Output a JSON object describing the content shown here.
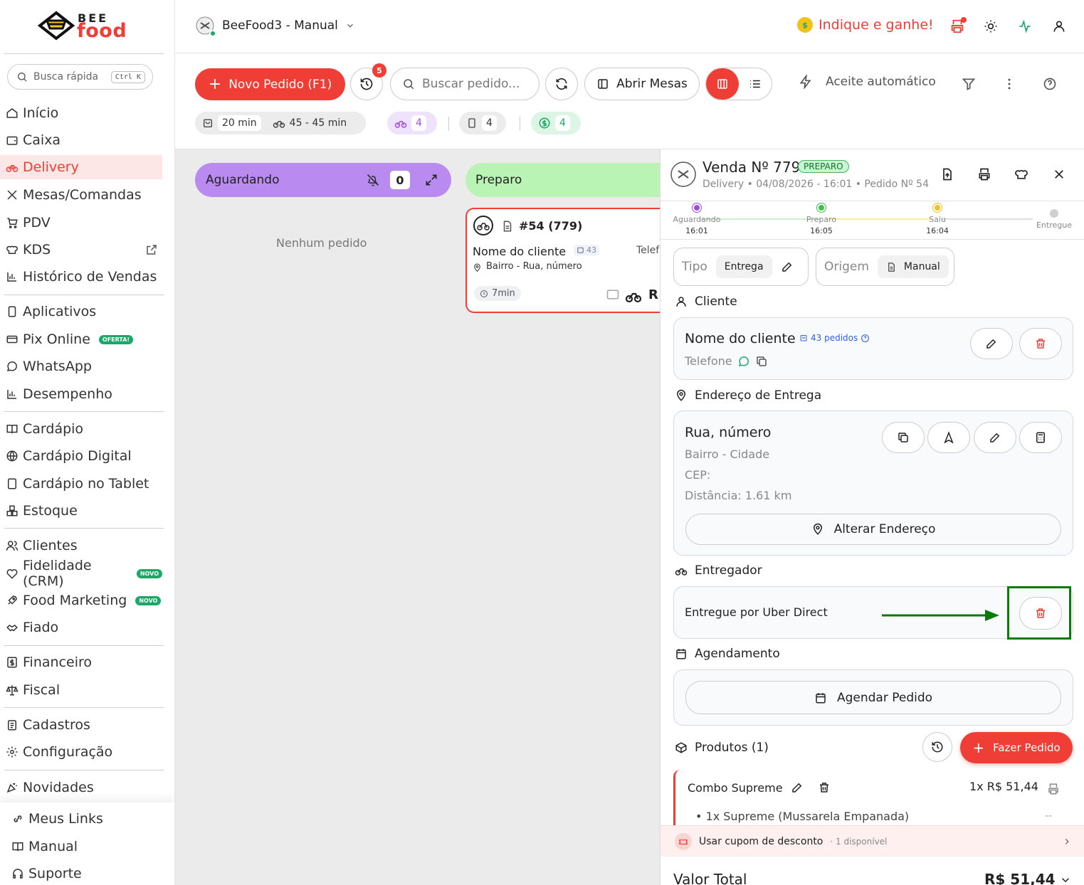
{
  "brand": {
    "bee": "BEE",
    "food": "food"
  },
  "sidebar": {
    "search_placeholder": "Busca rápida",
    "search_kbd": "Ctrl K",
    "items": [
      {
        "label": "Início"
      },
      {
        "label": "Caixa"
      },
      {
        "label": "Delivery",
        "active": true
      },
      {
        "label": "Mesas/Comandas"
      },
      {
        "label": "PDV"
      },
      {
        "label": "KDS"
      },
      {
        "label": "Histórico de Vendas"
      },
      {
        "label": "Aplicativos"
      },
      {
        "label": "Pix Online",
        "badge": "OFERTA!"
      },
      {
        "label": "WhatsApp"
      },
      {
        "label": "Desempenho"
      },
      {
        "label": "Cardápio"
      },
      {
        "label": "Cardápio Digital"
      },
      {
        "label": "Cardápio no Tablet"
      },
      {
        "label": "Estoque"
      },
      {
        "label": "Clientes"
      },
      {
        "label": "Fidelidade (CRM)",
        "badge": "NOVO"
      },
      {
        "label": "Food Marketing",
        "badge": "NOVO"
      },
      {
        "label": "Fiado"
      },
      {
        "label": "Financeiro"
      },
      {
        "label": "Fiscal"
      },
      {
        "label": "Cadastros"
      },
      {
        "label": "Configuração"
      },
      {
        "label": "Novidades"
      }
    ],
    "bottom": [
      {
        "label": "Meus Links"
      },
      {
        "label": "Manual"
      },
      {
        "label": "Suporte"
      }
    ]
  },
  "topbar": {
    "store_name": "BeeFood3 - Manual",
    "indique": "Indique e ganhe!"
  },
  "toolbar": {
    "new_order": "Novo Pedido (F1)",
    "history_badge": "5",
    "search_placeholder": "Buscar pedido...",
    "abrir_mesas": "Abrir Mesas",
    "aceite": "Aceite automático",
    "time_prep": "20 min",
    "time_delivery": "45 - 45 min",
    "count_delivery": "4",
    "count_tablet": "4",
    "count_money": "4"
  },
  "board": {
    "col_aguardando": "Aguardando",
    "col_aguardando_count": "0",
    "col_preparo": "Preparo",
    "empty": "Nenhum pedido",
    "card": {
      "number": "#54 (779)",
      "client": "Nome do cliente",
      "orders_count": "43",
      "phone_cut": "Telef",
      "address": "Bairro - Rua, número",
      "elapsed": "7min",
      "status_cut": "R"
    }
  },
  "panel": {
    "title": "Venda Nº 779",
    "status_badge": "PREPARO",
    "subtitle": "Delivery • 04/08/2026 - 16:01 • Pedido Nº 54",
    "timeline": [
      {
        "label": "Aguardando",
        "time": "16:01",
        "color": "#9b4de0"
      },
      {
        "label": "Preparo",
        "time": "16:05",
        "color": "#3cc246"
      },
      {
        "label": "Saiu",
        "time": "16:04",
        "color": "#f2c21b"
      },
      {
        "label": "Entregue",
        "time": "",
        "color": "#cfcfcf"
      }
    ],
    "tipo_label": "Tipo",
    "tipo_value": "Entrega",
    "origem_label": "Origem",
    "origem_value": "Manual",
    "cliente_title": "Cliente",
    "client_name": "Nome do cliente",
    "client_orders": "43 pedidos",
    "client_phone": "Telefone",
    "endereco_title": "Endereço de Entrega",
    "address_street": "Rua, número",
    "address_area": "Bairro - Cidade",
    "address_cep": "CEP:",
    "address_distance": "Distância: 1.61 km",
    "alterar_endereco": "Alterar Endereço",
    "entregador_title": "Entregador",
    "entregador_value": "Entregue por Uber Direct",
    "agendamento_title": "Agendamento",
    "agendar": "Agendar Pedido",
    "produtos_title": "Produtos (1)",
    "fazer_pedido": "Fazer Pedido",
    "product_name": "Combo Supreme",
    "product_price": "1x R$ 51,44",
    "product_item": "• 1x Supreme (Mussarela Empanada)",
    "product_item_price": "--",
    "cupom": "Usar cupom de desconto",
    "cupom_avail": "· 1 disponível",
    "total_label": "Valor Total",
    "total_value": "R$ 51,44"
  },
  "colors": {
    "accent": "#ef3e36",
    "highlight_box": "#0a7a0a",
    "arrow": "#0a7a0a"
  }
}
